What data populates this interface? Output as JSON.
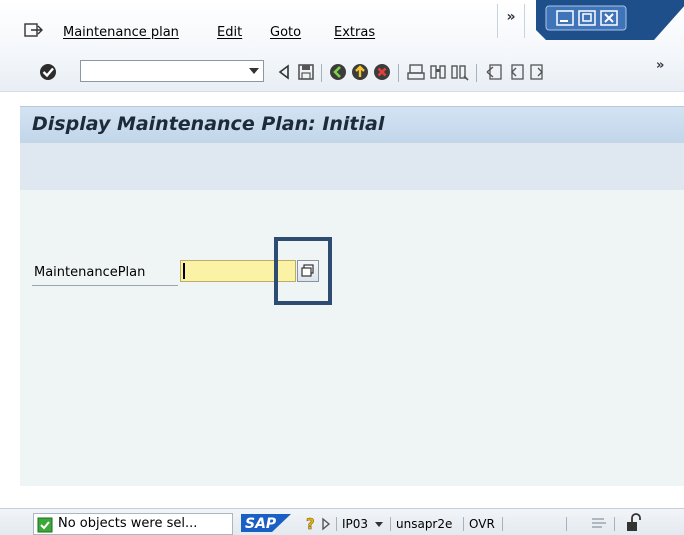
{
  "menubar": {
    "items": [
      "Maintenance plan",
      "Edit",
      "Goto",
      "Extras"
    ],
    "overflow": "»"
  },
  "toolbar": {
    "command_value": "",
    "overflow": "»"
  },
  "title": "Display Maintenance Plan: Initial",
  "form": {
    "label": "MaintenancePlan",
    "value": ""
  },
  "statusbar": {
    "message": "No objects were sel...",
    "logo": "SAP",
    "transaction": "IP03",
    "server": "unsapr2e",
    "mode": "OVR"
  },
  "colors": {
    "title_bar": "#c8dbee",
    "content_bg": "#eef5f4",
    "required_field": "#fbf2a6",
    "highlight": "#2e4c72",
    "sap_logo": "#1a5fc4"
  }
}
